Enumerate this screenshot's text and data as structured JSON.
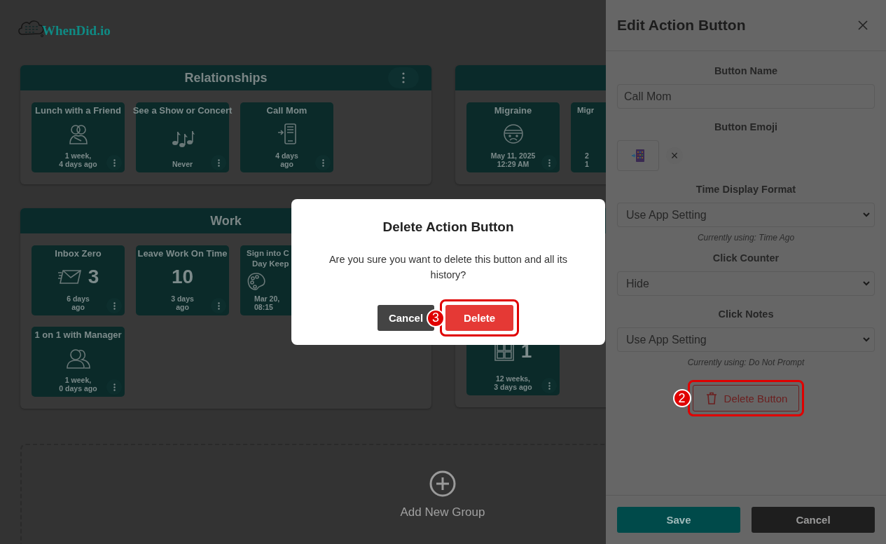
{
  "logo": {
    "text": "WhenDid.io"
  },
  "columns": [
    {
      "groups": [
        {
          "title": "Relationships",
          "menu": true,
          "cards": [
            {
              "title": "Lunch with a Friend",
              "time": [
                "1 week,",
                "4 days ago"
              ]
            },
            {
              "title": "See a Show or Concert",
              "time": [
                "Never"
              ]
            },
            {
              "title": "Call Mom",
              "time": [
                "4 days",
                "ago"
              ]
            }
          ]
        },
        {
          "title": "Work",
          "cards": [
            {
              "title": "Inbox Zero",
              "count": "3",
              "time": [
                "6 days",
                "ago"
              ]
            },
            {
              "title": "Leave Work On Time",
              "count": "10",
              "time": [
                "3 days",
                "ago"
              ]
            },
            {
              "title": "Sign into C",
              "title2": "Day Keep",
              "cut": true,
              "time": [
                "Mar 20,",
                "08:15"
              ]
            },
            {
              "title": "1 on 1 with Manager",
              "time": [
                "1 week,",
                "0 days ago"
              ]
            }
          ]
        }
      ]
    },
    {
      "groups": [
        {
          "cards": [
            {
              "title": "Migraine",
              "time": [
                "May 11, 2025",
                "12:29 AM"
              ]
            },
            {
              "title": "Migr",
              "cut": true,
              "time": [
                "2",
                "1"
              ]
            }
          ]
        },
        {
          "cards": [
            {
              "count": "1",
              "time": [
                "12 weeks,",
                "3 days ago"
              ]
            }
          ]
        }
      ]
    }
  ],
  "add_group": {
    "label": "Add New Group"
  },
  "panel": {
    "title": "Edit Action Button",
    "fields": [
      {
        "kind": "text",
        "label": "Button Name",
        "value": "Call Mom"
      },
      {
        "kind": "emoji",
        "label": "Button Emoji",
        "clear": "×"
      },
      {
        "kind": "select",
        "label": "Time Display Format",
        "value": "Use App Setting",
        "note": "Currently using: Time Ago"
      },
      {
        "kind": "select",
        "label": "Click Counter",
        "value": "Hide"
      },
      {
        "kind": "select",
        "label": "Click Notes",
        "value": "Use App Setting",
        "note": "Currently using: Do Not Prompt"
      }
    ],
    "delete_button": {
      "label": "Delete Button",
      "callout": "2"
    },
    "buttons": [
      {
        "label": "Save",
        "kind": "primary"
      },
      {
        "label": "Cancel",
        "kind": "secondary"
      }
    ]
  },
  "modal": {
    "title": "Delete Action Button",
    "message": "Are you sure you want to delete this button and all its history?",
    "buttons": [
      {
        "label": "Cancel",
        "kind": "secondary"
      },
      {
        "label": "Delete",
        "kind": "danger",
        "callout": "3"
      }
    ]
  }
}
